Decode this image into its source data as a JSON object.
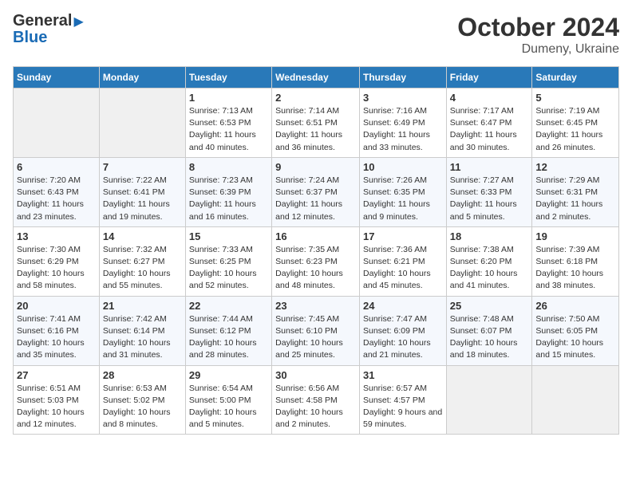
{
  "header": {
    "logo_general": "General",
    "logo_blue": "Blue",
    "month": "October 2024",
    "location": "Dumeny, Ukraine"
  },
  "columns": [
    "Sunday",
    "Monday",
    "Tuesday",
    "Wednesday",
    "Thursday",
    "Friday",
    "Saturday"
  ],
  "weeks": [
    [
      {
        "day": "",
        "info": ""
      },
      {
        "day": "",
        "info": ""
      },
      {
        "day": "1",
        "info": "Sunrise: 7:13 AM\nSunset: 6:53 PM\nDaylight: 11 hours and 40 minutes."
      },
      {
        "day": "2",
        "info": "Sunrise: 7:14 AM\nSunset: 6:51 PM\nDaylight: 11 hours and 36 minutes."
      },
      {
        "day": "3",
        "info": "Sunrise: 7:16 AM\nSunset: 6:49 PM\nDaylight: 11 hours and 33 minutes."
      },
      {
        "day": "4",
        "info": "Sunrise: 7:17 AM\nSunset: 6:47 PM\nDaylight: 11 hours and 30 minutes."
      },
      {
        "day": "5",
        "info": "Sunrise: 7:19 AM\nSunset: 6:45 PM\nDaylight: 11 hours and 26 minutes."
      }
    ],
    [
      {
        "day": "6",
        "info": "Sunrise: 7:20 AM\nSunset: 6:43 PM\nDaylight: 11 hours and 23 minutes."
      },
      {
        "day": "7",
        "info": "Sunrise: 7:22 AM\nSunset: 6:41 PM\nDaylight: 11 hours and 19 minutes."
      },
      {
        "day": "8",
        "info": "Sunrise: 7:23 AM\nSunset: 6:39 PM\nDaylight: 11 hours and 16 minutes."
      },
      {
        "day": "9",
        "info": "Sunrise: 7:24 AM\nSunset: 6:37 PM\nDaylight: 11 hours and 12 minutes."
      },
      {
        "day": "10",
        "info": "Sunrise: 7:26 AM\nSunset: 6:35 PM\nDaylight: 11 hours and 9 minutes."
      },
      {
        "day": "11",
        "info": "Sunrise: 7:27 AM\nSunset: 6:33 PM\nDaylight: 11 hours and 5 minutes."
      },
      {
        "day": "12",
        "info": "Sunrise: 7:29 AM\nSunset: 6:31 PM\nDaylight: 11 hours and 2 minutes."
      }
    ],
    [
      {
        "day": "13",
        "info": "Sunrise: 7:30 AM\nSunset: 6:29 PM\nDaylight: 10 hours and 58 minutes."
      },
      {
        "day": "14",
        "info": "Sunrise: 7:32 AM\nSunset: 6:27 PM\nDaylight: 10 hours and 55 minutes."
      },
      {
        "day": "15",
        "info": "Sunrise: 7:33 AM\nSunset: 6:25 PM\nDaylight: 10 hours and 52 minutes."
      },
      {
        "day": "16",
        "info": "Sunrise: 7:35 AM\nSunset: 6:23 PM\nDaylight: 10 hours and 48 minutes."
      },
      {
        "day": "17",
        "info": "Sunrise: 7:36 AM\nSunset: 6:21 PM\nDaylight: 10 hours and 45 minutes."
      },
      {
        "day": "18",
        "info": "Sunrise: 7:38 AM\nSunset: 6:20 PM\nDaylight: 10 hours and 41 minutes."
      },
      {
        "day": "19",
        "info": "Sunrise: 7:39 AM\nSunset: 6:18 PM\nDaylight: 10 hours and 38 minutes."
      }
    ],
    [
      {
        "day": "20",
        "info": "Sunrise: 7:41 AM\nSunset: 6:16 PM\nDaylight: 10 hours and 35 minutes."
      },
      {
        "day": "21",
        "info": "Sunrise: 7:42 AM\nSunset: 6:14 PM\nDaylight: 10 hours and 31 minutes."
      },
      {
        "day": "22",
        "info": "Sunrise: 7:44 AM\nSunset: 6:12 PM\nDaylight: 10 hours and 28 minutes."
      },
      {
        "day": "23",
        "info": "Sunrise: 7:45 AM\nSunset: 6:10 PM\nDaylight: 10 hours and 25 minutes."
      },
      {
        "day": "24",
        "info": "Sunrise: 7:47 AM\nSunset: 6:09 PM\nDaylight: 10 hours and 21 minutes."
      },
      {
        "day": "25",
        "info": "Sunrise: 7:48 AM\nSunset: 6:07 PM\nDaylight: 10 hours and 18 minutes."
      },
      {
        "day": "26",
        "info": "Sunrise: 7:50 AM\nSunset: 6:05 PM\nDaylight: 10 hours and 15 minutes."
      }
    ],
    [
      {
        "day": "27",
        "info": "Sunrise: 6:51 AM\nSunset: 5:03 PM\nDaylight: 10 hours and 12 minutes."
      },
      {
        "day": "28",
        "info": "Sunrise: 6:53 AM\nSunset: 5:02 PM\nDaylight: 10 hours and 8 minutes."
      },
      {
        "day": "29",
        "info": "Sunrise: 6:54 AM\nSunset: 5:00 PM\nDaylight: 10 hours and 5 minutes."
      },
      {
        "day": "30",
        "info": "Sunrise: 6:56 AM\nSunset: 4:58 PM\nDaylight: 10 hours and 2 minutes."
      },
      {
        "day": "31",
        "info": "Sunrise: 6:57 AM\nSunset: 4:57 PM\nDaylight: 9 hours and 59 minutes."
      },
      {
        "day": "",
        "info": ""
      },
      {
        "day": "",
        "info": ""
      }
    ]
  ]
}
